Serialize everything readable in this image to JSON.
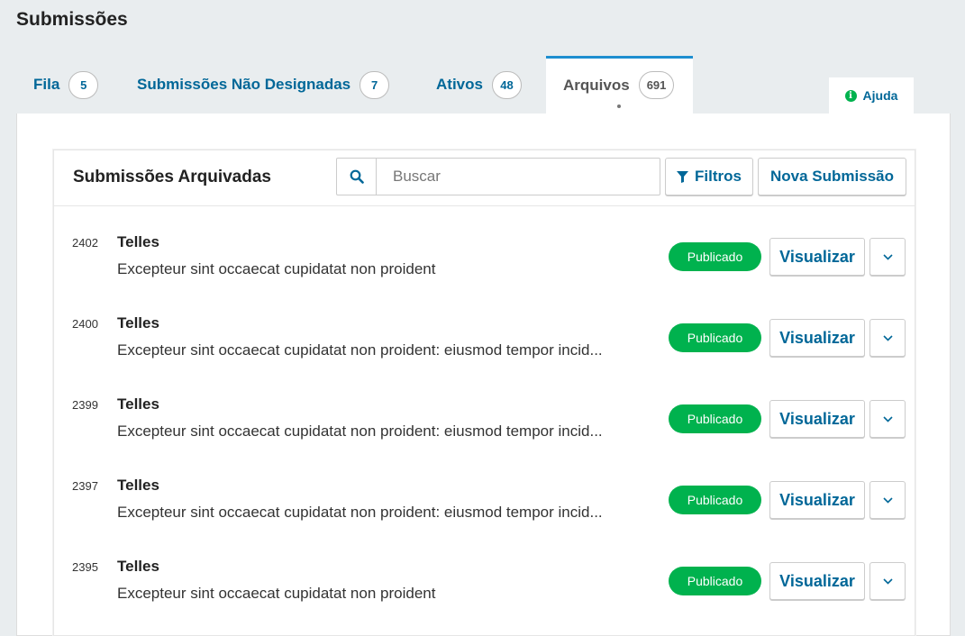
{
  "page_title": "Submissões",
  "tabs": [
    {
      "label": "Fila",
      "count": "5"
    },
    {
      "label": "Submissões Não Designadas",
      "count": "7"
    },
    {
      "label": "Ativos",
      "count": "48"
    },
    {
      "label": "Arquivos",
      "count": "691"
    }
  ],
  "help": {
    "label": "Ajuda",
    "icon": "info-icon"
  },
  "card": {
    "title": "Submissões Arquivadas",
    "search": {
      "placeholder": "Buscar",
      "value": ""
    },
    "filters_label": "Filtros",
    "new_submission_label": "Nova Submissão"
  },
  "submissions": [
    {
      "id": "2402",
      "author": "Telles",
      "title": "Excepteur sint occaecat cupidatat non proident",
      "status": "Publicado",
      "view_label": "Visualizar"
    },
    {
      "id": "2400",
      "author": "Telles",
      "title": "Excepteur sint occaecat cupidatat non proident: eiusmod tempor incid...",
      "status": "Publicado",
      "view_label": "Visualizar"
    },
    {
      "id": "2399",
      "author": "Telles",
      "title": "Excepteur sint occaecat cupidatat non proident: eiusmod tempor incid...",
      "status": "Publicado",
      "view_label": "Visualizar"
    },
    {
      "id": "2397",
      "author": "Telles",
      "title": "Excepteur sint occaecat cupidatat non proident: eiusmod tempor incid...",
      "status": "Publicado",
      "view_label": "Visualizar"
    },
    {
      "id": "2395",
      "author": "Telles",
      "title": "Excepteur sint occaecat cupidatat non proident",
      "status": "Publicado",
      "view_label": "Visualizar"
    }
  ],
  "colors": {
    "accent": "#006798",
    "tab_active_border": "#1e8ed0",
    "status_published": "#00b24e"
  }
}
